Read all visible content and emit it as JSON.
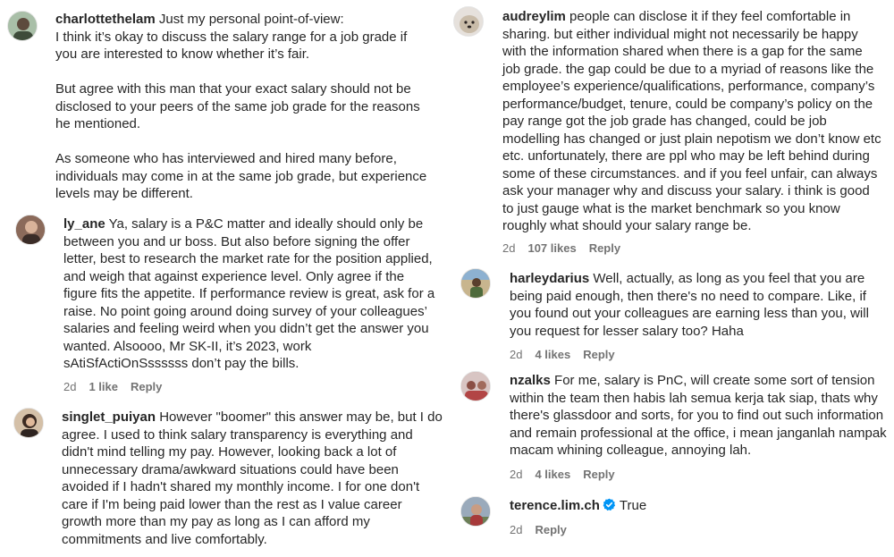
{
  "comments_left": [
    {
      "username": "charlottethelam",
      "text": "Just my personal point-of-view:\nI think it’s okay to discuss the salary range for a job grade if you are interested to know whether it’s fair.\n\nBut agree with this man that your exact salary should not be disclosed to your peers of the same job grade for the reasons he mentioned.\n\nAs someone who has interviewed and hired many before, individuals may come in at the same job grade, but experience levels may be different."
    },
    {
      "username": "ly_ane",
      "text": "Ya, salary is a P&C matter and ideally should only be between you and ur boss. But also before signing the offer letter, best to research the market rate for the position applied, and weigh that against experience level. Only agree if the figure fits the appetite. If performance review is great, ask for a raise. No point going around doing survey of your colleagues’ salaries and feeling weird when you didn’t get the answer you wanted. Alsoooo, Mr SK-II, it’s 2023, work sAtiSfActiOnSssssss don’t pay the bills.",
      "time": "2d",
      "likes": "1 like",
      "reply": "Reply"
    },
    {
      "username": "singlet_puiyan",
      "text": "However \"boomer\" this answer may be, but I do agree. I used to think salary transparency is everything and didn't mind telling my pay. However, looking back a lot of unnecessary drama/awkward situations could have been avoided if I hadn't shared my monthly income. I for one don't care if I'm being paid lower than the rest as I value career growth more than my pay as long as I can afford my commitments and live comfortably."
    }
  ],
  "comments_right": [
    {
      "username": "audreylim",
      "text": "people can disclose it if they feel comfortable in sharing. but either individual might not necessarily be happy with the information shared when there is a gap for the same job grade. the gap could be due to a myriad of reasons like the employee’s experience/qualifications, performance, company’s performance/budget, tenure, could be company’s policy on the pay range got the job grade has changed, could be job modelling has changed or just plain nepotism we don’t know etc etc. unfortunately, there are ppl who may be left behind during some of these circumstances. and if you feel unfair, can always ask your manager why and discuss your salary. i think is good to just gauge what is the market benchmark so you know roughly what should your salary range be.",
      "time": "2d",
      "likes": "107 likes",
      "reply": "Reply"
    },
    {
      "username": "harleydarius",
      "text": "Well, actually, as long as you feel that you are being paid enough, then there's no need to compare. Like, if you found out your colleagues are earning less than you, will you request for lesser salary too? Haha",
      "time": "2d",
      "likes": "4 likes",
      "reply": "Reply"
    },
    {
      "username": "nzalks",
      "text": "For me, salary is PnC, will create some sort of tension within the team then habis lah semua kerja tak siap, thats why there's glassdoor and sorts, for you to find out such information and remain professional at the office, i mean janganlah nampak macam whining colleague, annoying lah.",
      "time": "2d",
      "likes": "4 likes",
      "reply": "Reply"
    },
    {
      "username": "terence.lim.ch",
      "text": "True",
      "time": "2d",
      "reply": "Reply"
    }
  ],
  "colors": {
    "text": "#262626",
    "meta": "#737373",
    "verified": "#0095f6"
  },
  "icons": {
    "verified": "verified-badge-icon"
  }
}
